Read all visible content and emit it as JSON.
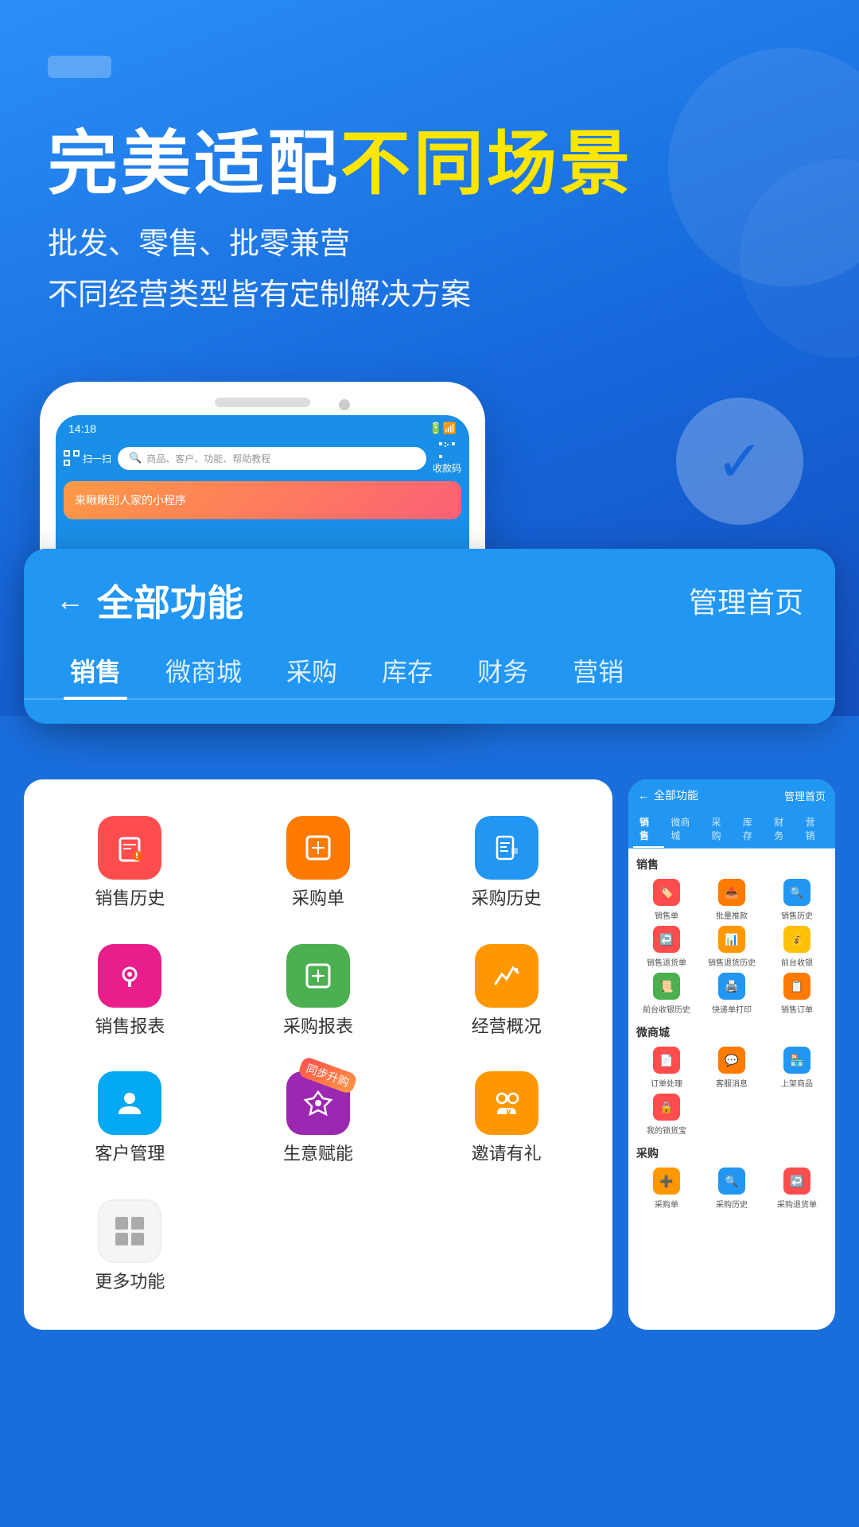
{
  "header": {
    "headline_white": "完美适配",
    "headline_yellow": "不同场景",
    "subline1": "批发、零售、批零兼营",
    "subline2": "不同经营类型皆有定制解决方案"
  },
  "phone": {
    "time": "14:18",
    "search_placeholder": "商品、客户、功能、帮助教程",
    "scan_label": "扫一扫",
    "qr_label": "收款码",
    "banner_text": "来瞅瞅别人家的小程序"
  },
  "func_card": {
    "back_label": "←",
    "title": "全部功能",
    "manage_label": "管理首页",
    "tabs": [
      "销售",
      "微商城",
      "采购",
      "库存",
      "财务",
      "营销"
    ]
  },
  "app_grid": {
    "items": [
      {
        "label": "销售历史",
        "icon": "🏷️",
        "color": "red"
      },
      {
        "label": "采购单",
        "icon": "➕",
        "color": "orange"
      },
      {
        "label": "采购历史",
        "icon": "📋",
        "color": "blue"
      },
      {
        "label": "销售报表",
        "icon": "❤️",
        "color": "pink"
      },
      {
        "label": "采购报表",
        "icon": "➕",
        "color": "green"
      },
      {
        "label": "经营概况",
        "icon": "📈",
        "color": "gold"
      },
      {
        "label": "客户管理",
        "icon": "👤",
        "color": "light-blue"
      },
      {
        "label": "生意赋能",
        "icon": "🔄",
        "color": "purple",
        "badge": "同步升购"
      },
      {
        "label": "邀请有礼",
        "icon": "💰",
        "color": "gold"
      },
      {
        "label": "更多功能",
        "icon": "⊞",
        "color": "gray"
      }
    ]
  },
  "mini_panel": {
    "header_left": "← 全部功能",
    "header_right": "管理首页",
    "tabs": [
      "销售",
      "微商城",
      "采购",
      "库存",
      "财务",
      "营销"
    ],
    "active_tab": "销售",
    "sections": [
      {
        "title": "销售",
        "items": [
          {
            "label": "销售单",
            "icon": "🏷️",
            "color": "red"
          },
          {
            "label": "批量推款",
            "icon": "📤",
            "color": "orange"
          },
          {
            "label": "销售历史",
            "icon": "🔍",
            "color": "blue"
          },
          {
            "label": "销售退货单",
            "icon": "↩️",
            "color": "red"
          },
          {
            "label": "销售退货历史",
            "icon": "📊",
            "color": "orange"
          },
          {
            "label": "前台收银",
            "icon": "💰",
            "color": "gold"
          },
          {
            "label": "前台收银历史",
            "icon": "📜",
            "color": "green"
          },
          {
            "label": "快递单打印",
            "icon": "🖨️",
            "color": "blue"
          },
          {
            "label": "销售订单",
            "icon": "📋",
            "color": "orange"
          }
        ]
      },
      {
        "title": "微商城",
        "items": [
          {
            "label": "订单处理",
            "icon": "📄",
            "color": "red"
          },
          {
            "label": "客服消息",
            "icon": "💬",
            "color": "orange"
          },
          {
            "label": "上架商品",
            "icon": "🏪",
            "color": "blue"
          },
          {
            "label": "我的锁货宝",
            "icon": "🔒",
            "color": "red"
          }
        ]
      },
      {
        "title": "采购",
        "items": [
          {
            "label": "采购单",
            "icon": "➕",
            "color": "orange"
          },
          {
            "label": "采购历史",
            "icon": "🔍",
            "color": "blue"
          },
          {
            "label": "采购退货单",
            "icon": "↩️",
            "color": "red"
          }
        ]
      }
    ]
  },
  "colors": {
    "bg_blue": "#1a6edc",
    "accent_yellow": "#FFE600",
    "card_blue": "#2196f3"
  }
}
